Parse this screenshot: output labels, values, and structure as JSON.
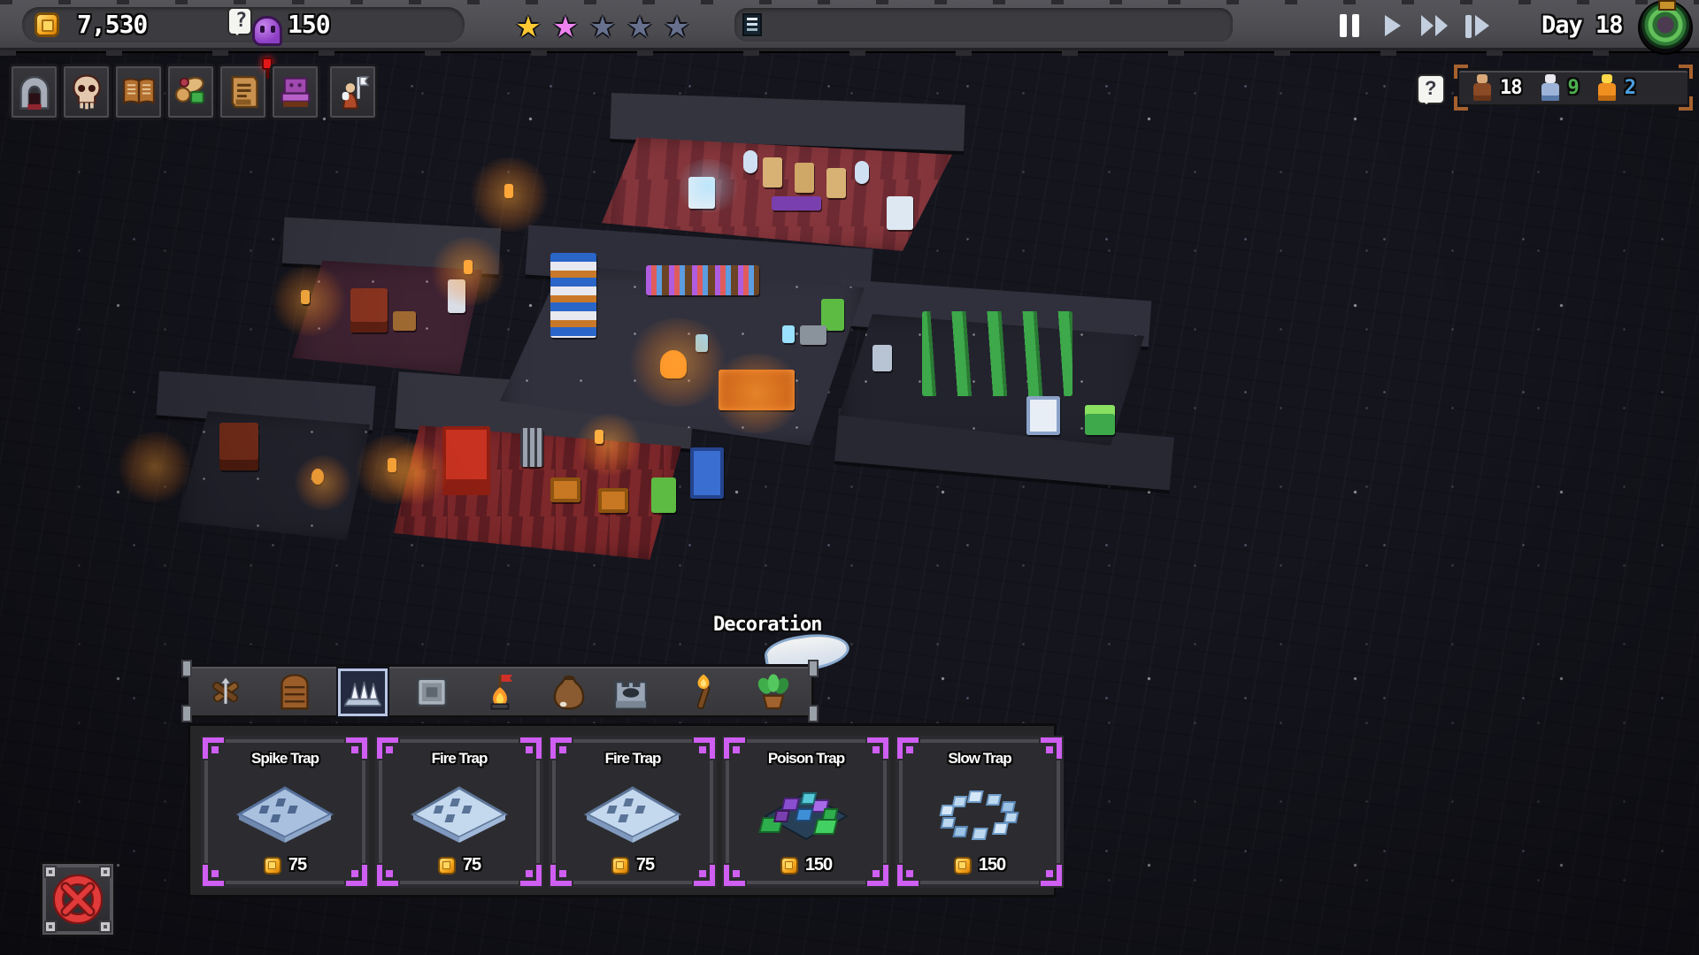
{
  "currency": {
    "gold": "7,530",
    "souls": "150"
  },
  "rating": {
    "filled": 2,
    "total": 5
  },
  "day_counter": "Day 18",
  "menu": {
    "items": [
      {
        "icon": "dungeon-entrance-icon"
      },
      {
        "icon": "skull-icon"
      },
      {
        "icon": "book-icon"
      },
      {
        "icon": "supplies-icon"
      },
      {
        "icon": "scroll-icon",
        "notification": true
      },
      {
        "icon": "throne-icon"
      },
      {
        "icon": "hero-flag-icon"
      }
    ]
  },
  "population": {
    "entries": [
      {
        "icon": "minion-brown",
        "count": "18",
        "color": "#ffffff"
      },
      {
        "icon": "worker-white",
        "count": "9",
        "color": "#4cae4f"
      },
      {
        "icon": "hero-orange",
        "count": "2",
        "color": "#4a9fe0"
      }
    ]
  },
  "tooltip": {
    "text": "Decoration"
  },
  "build_menu": {
    "tabs": [
      {
        "icon": "ballista-icon",
        "selected": false
      },
      {
        "icon": "door-icon",
        "selected": false
      },
      {
        "icon": "spike-trap-icon",
        "selected": true
      },
      {
        "icon": "pressure-plate-icon",
        "selected": false
      },
      {
        "icon": "brazier-icon",
        "selected": false
      },
      {
        "icon": "bag-icon",
        "selected": false
      },
      {
        "icon": "well-icon",
        "selected": false
      },
      {
        "icon": "torch-icon",
        "selected": false
      },
      {
        "icon": "plant-icon",
        "selected": false
      }
    ],
    "cards": [
      {
        "title": "Spike Trap",
        "price": "75"
      },
      {
        "title": "Fire Trap",
        "price": "75"
      },
      {
        "title": "Fire Trap",
        "price": "75"
      },
      {
        "title": "Poison Trap",
        "price": "150"
      },
      {
        "title": "Slow Trap",
        "price": "150"
      }
    ]
  },
  "colors": {
    "accent_purple": "#cf5ef2",
    "gold": "#ffcf3e",
    "count_white": "#ffffff",
    "count_green": "#4cae4f",
    "count_blue": "#4a9fe0",
    "star_gold": "#ffc832",
    "star_pink": "#ee82ee",
    "star_empty": "#67718e"
  }
}
